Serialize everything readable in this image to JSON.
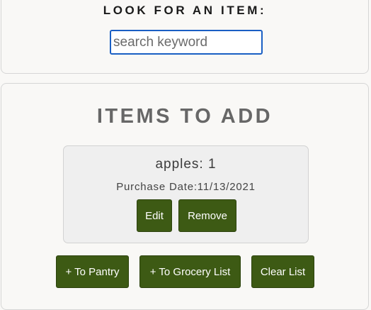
{
  "search": {
    "heading": "LOOK FOR AN ITEM:",
    "placeholder": "search keyword",
    "value": ""
  },
  "items_section": {
    "heading": "ITEMS TO ADD",
    "items": [
      {
        "name_qty": "apples: 1",
        "purchase_date": "Purchase Date:11/13/2021",
        "edit_label": "Edit",
        "remove_label": "Remove"
      }
    ],
    "actions": {
      "to_pantry": "+ To Pantry",
      "to_grocery": "+ To Grocery List",
      "clear": "Clear List"
    }
  },
  "colors": {
    "button": "#3d5a14",
    "focus_border": "#1a5fc4"
  }
}
